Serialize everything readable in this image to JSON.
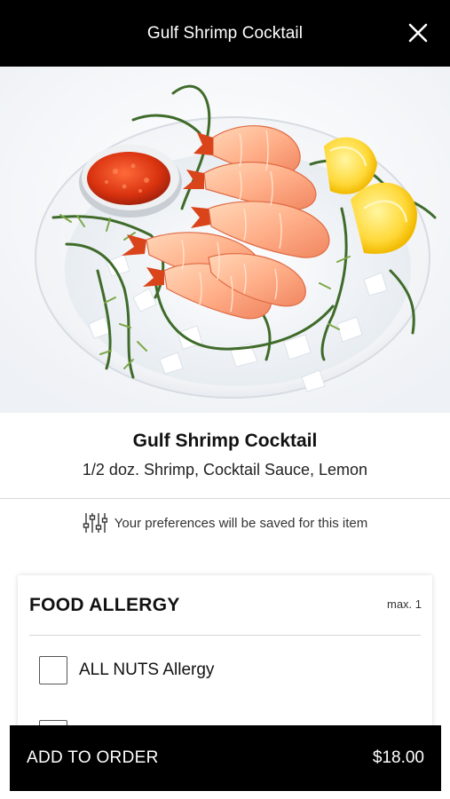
{
  "header": {
    "title": "Gulf Shrimp Cocktail"
  },
  "item": {
    "title": "Gulf Shrimp Cocktail",
    "description": "1/2 doz. Shrimp, Cocktail Sauce, Lemon"
  },
  "preferences": {
    "note": "Your preferences will be saved for this item",
    "icon": "sliders-icon"
  },
  "allergy_group": {
    "title": "FOOD ALLERGY",
    "max_label": "max. 1",
    "options": [
      {
        "label": "ALL NUTS Allergy",
        "checked": false
      }
    ]
  },
  "footer": {
    "add_label": "ADD TO ORDER",
    "price": "$18.00"
  },
  "colors": {
    "header_bg": "#000000",
    "footer_bg": "#000000",
    "text": "#111111",
    "divider": "#d6d6d6"
  }
}
